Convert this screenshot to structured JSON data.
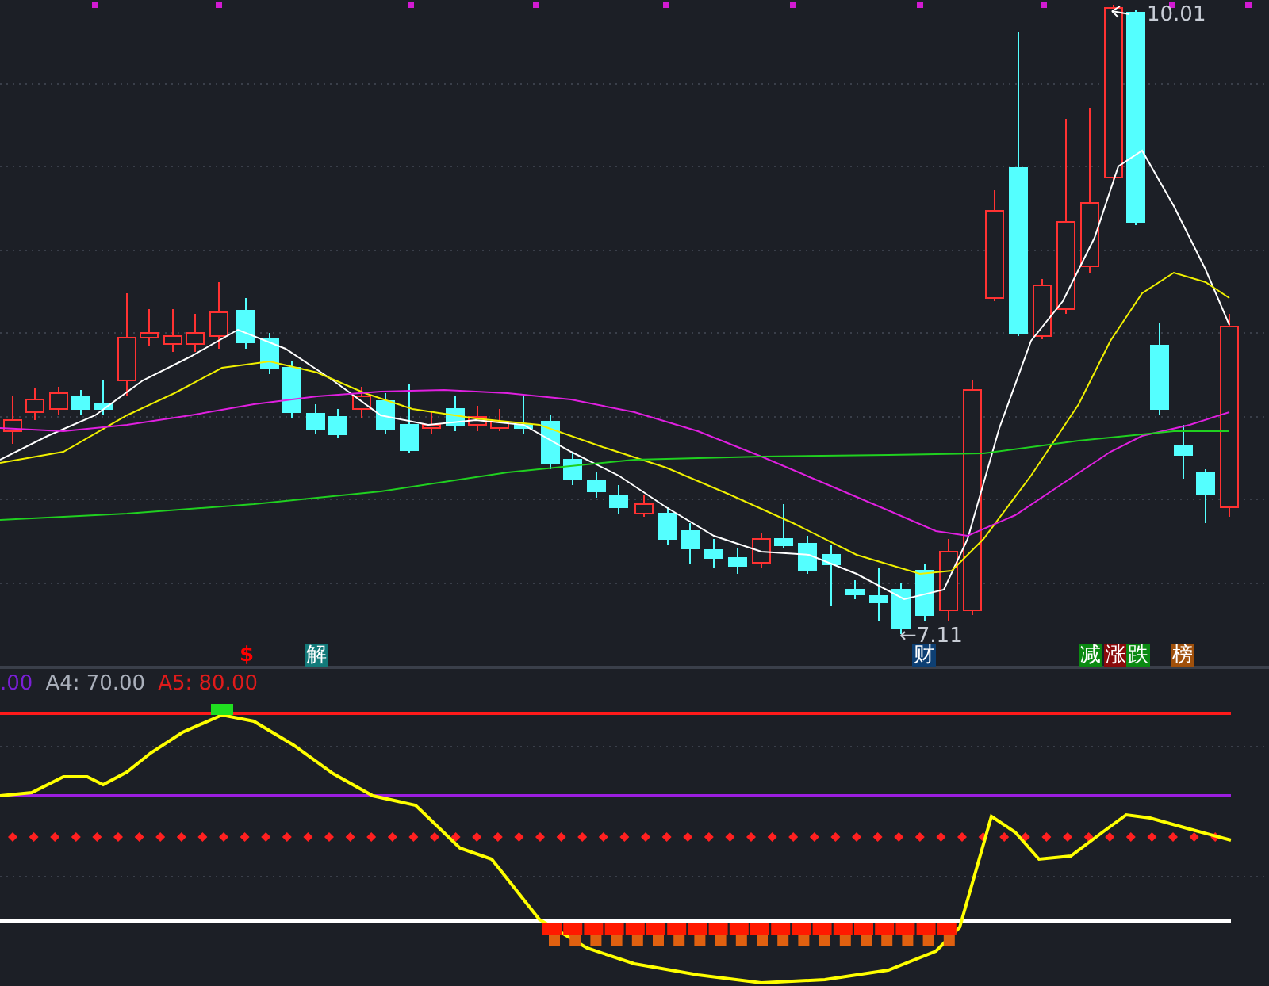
{
  "price_labels": [
    {
      "text": "10.01",
      "kind": "high"
    },
    {
      "text": "←7.11",
      "kind": "low"
    }
  ],
  "signals": [
    {
      "text": "$",
      "color": "#ff0000",
      "kind": "plain"
    },
    {
      "text": "解",
      "color": "#137a7a",
      "kind": "badge"
    },
    {
      "text": "财",
      "color": "#0d3f73",
      "kind": "badge"
    },
    {
      "text": "减",
      "color": "#0b8a12",
      "kind": "badge"
    },
    {
      "text": "涨",
      "color": "#8a0b0b",
      "kind": "badge"
    },
    {
      "text": "跌",
      "color": "#0b8a12",
      "kind": "badge"
    },
    {
      "text": "榜",
      "color": "#a0500b",
      "kind": "badge"
    }
  ],
  "legend": [
    {
      "text": ".00",
      "color": "#7a1fd6"
    },
    {
      "text": "A4: 70.00",
      "color": "#aab0bb"
    },
    {
      "text": "A5: 80.00",
      "color": "#e01b1b"
    }
  ]
}
